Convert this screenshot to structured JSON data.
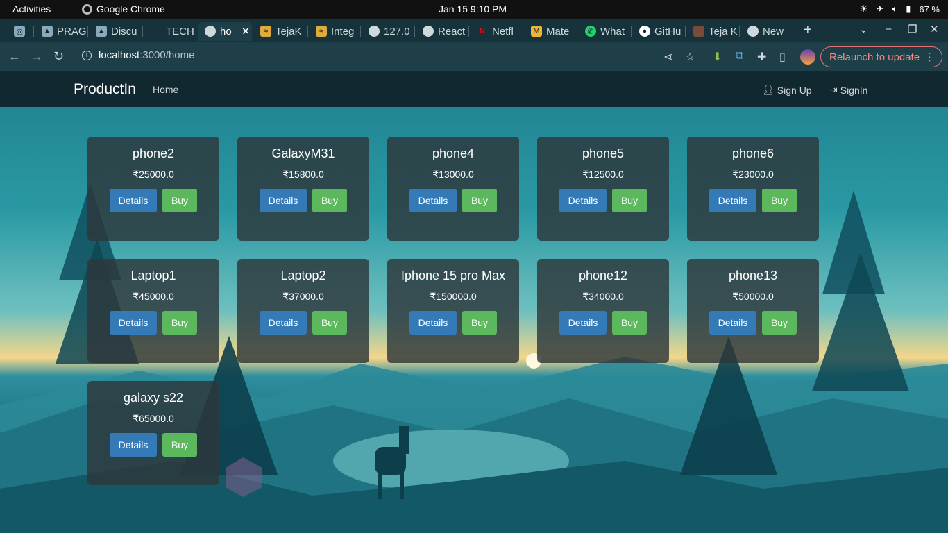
{
  "os": {
    "activities": "Activities",
    "app_name": "Google Chrome",
    "clock": "Jan 15  9:10 PM",
    "battery": "67 %"
  },
  "tabs": [
    {
      "label": ""
    },
    {
      "label": "PRAG"
    },
    {
      "label": "Discu"
    },
    {
      "label": "TECH"
    },
    {
      "label": "ho"
    },
    {
      "label": "TejaK"
    },
    {
      "label": "Integ"
    },
    {
      "label": "127.0"
    },
    {
      "label": "React"
    },
    {
      "label": "Netfl"
    },
    {
      "label": "Mate"
    },
    {
      "label": "What"
    },
    {
      "label": "GitHu"
    },
    {
      "label": "Teja K"
    },
    {
      "label": "New"
    }
  ],
  "browser": {
    "url_host": "localhost",
    "url_path": ":3000/home",
    "relaunch_label": "Relaunch to update"
  },
  "site": {
    "brand": "ProductIn",
    "home": "Home",
    "signup": "Sign Up",
    "signin": "SignIn"
  },
  "products": [
    {
      "name": "phone2",
      "price": "₹25000.0"
    },
    {
      "name": "GalaxyM31",
      "price": "₹15800.0"
    },
    {
      "name": "phone4",
      "price": "₹13000.0"
    },
    {
      "name": "phone5",
      "price": "₹12500.0"
    },
    {
      "name": "phone6",
      "price": "₹23000.0"
    },
    {
      "name": "Laptop1",
      "price": "₹45000.0"
    },
    {
      "name": "Laptop2",
      "price": "₹37000.0"
    },
    {
      "name": "Iphone 15 pro Max",
      "price": "₹150000.0"
    },
    {
      "name": "phone12",
      "price": "₹34000.0"
    },
    {
      "name": "phone13",
      "price": "₹50000.0"
    },
    {
      "name": "galaxy s22",
      "price": "₹65000.0"
    }
  ],
  "buttons": {
    "details": "Details",
    "buy": "Buy"
  }
}
